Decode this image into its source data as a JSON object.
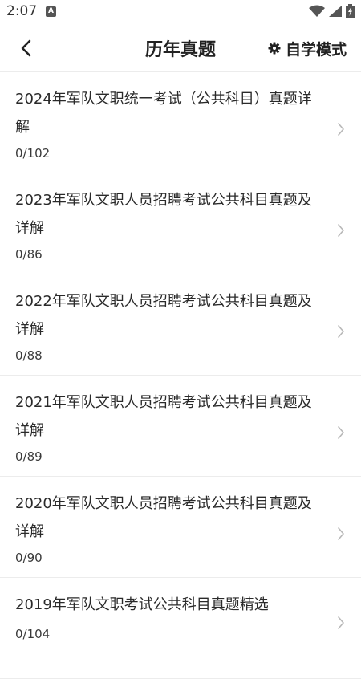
{
  "status_bar": {
    "time": "2:07",
    "notification_badge": "A",
    "icons": [
      "wifi-icon",
      "signal-icon",
      "battery-icon"
    ]
  },
  "header": {
    "title": "历年真题",
    "back_icon": "chevron-left-icon",
    "mode_label": "自学模式",
    "mode_icon": "gear-icon"
  },
  "items": [
    {
      "title": "2024年军队文职统一考试（公共科目）真题详解",
      "progress": "0/102"
    },
    {
      "title": "2023年军队文职人员招聘考试公共科目真题及详解",
      "progress": "0/86"
    },
    {
      "title": "2022年军队文职人员招聘考试公共科目真题及详解",
      "progress": "0/88"
    },
    {
      "title": "2021年军队文职人员招聘考试公共科目真题及详解",
      "progress": "0/89"
    },
    {
      "title": "2020年军队文职人员招聘考试公共科目真题及详解",
      "progress": "0/90"
    },
    {
      "title": "2019年军队文职考试公共科目真题精选",
      "progress": "0/104"
    }
  ],
  "colors": {
    "background": "#ffffff",
    "text": "#222222",
    "divider": "#ececec",
    "chevron": "#b8b8b8"
  }
}
